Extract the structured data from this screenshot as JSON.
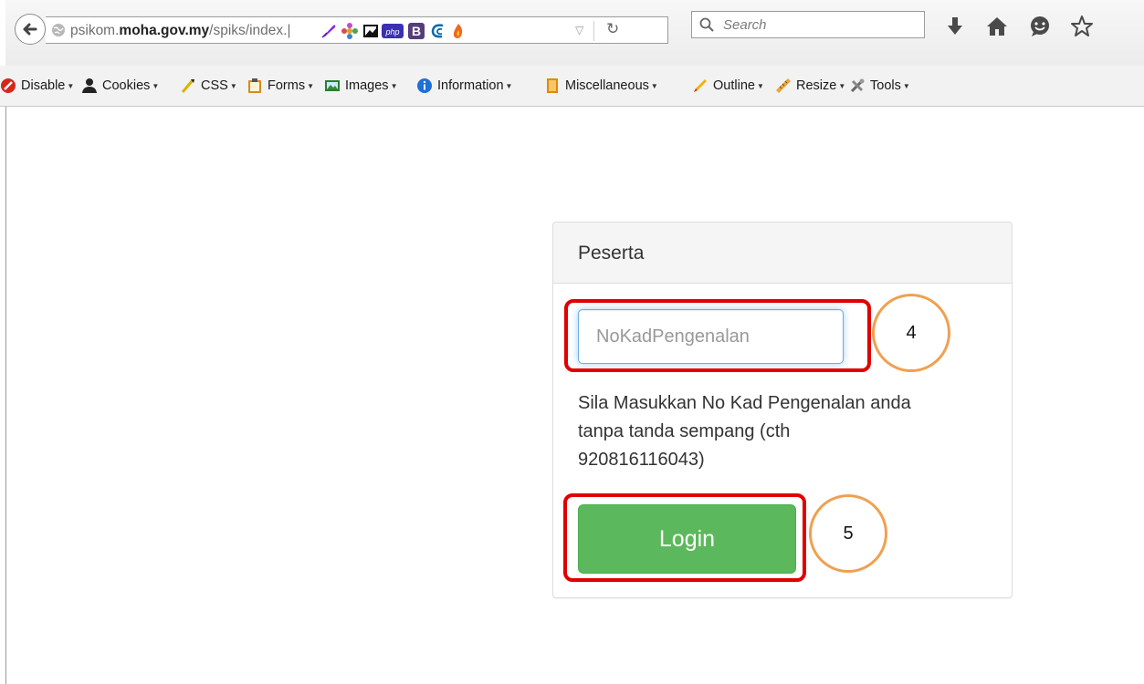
{
  "browser": {
    "url_prefix": "psikom.",
    "url_domain": "moha.gov.my",
    "url_path": "/spiks/index.|",
    "search_placeholder": "Search"
  },
  "devbar": {
    "items": [
      {
        "label": "Disable",
        "icon": "disable-icon"
      },
      {
        "label": "Cookies",
        "icon": "cookies-icon"
      },
      {
        "label": "CSS",
        "icon": "css-icon"
      },
      {
        "label": "Forms",
        "icon": "forms-icon"
      },
      {
        "label": "Images",
        "icon": "images-icon"
      },
      {
        "label": "Information",
        "icon": "information-icon"
      },
      {
        "label": "Miscellaneous",
        "icon": "miscellaneous-icon"
      },
      {
        "label": "Outline",
        "icon": "outline-icon"
      },
      {
        "label": "Resize",
        "icon": "resize-icon"
      },
      {
        "label": "Tools",
        "icon": "tools-icon"
      }
    ]
  },
  "panel": {
    "heading": "Peserta",
    "input_placeholder": "NoKadPengenalan",
    "help_text_line1": "Sila Masukkan No Kad Pengenalan anda",
    "help_text_line2": "tanpa tanda sempang (cth",
    "help_text_line3": "920816116043)",
    "login_label": "Login"
  },
  "annotations": {
    "step_input": "4",
    "step_login": "5",
    "highlight_color": "#e00000",
    "circle_color": "#f0a050"
  },
  "colors": {
    "login_green": "#5cb85c",
    "input_focus": "#66afe9"
  }
}
